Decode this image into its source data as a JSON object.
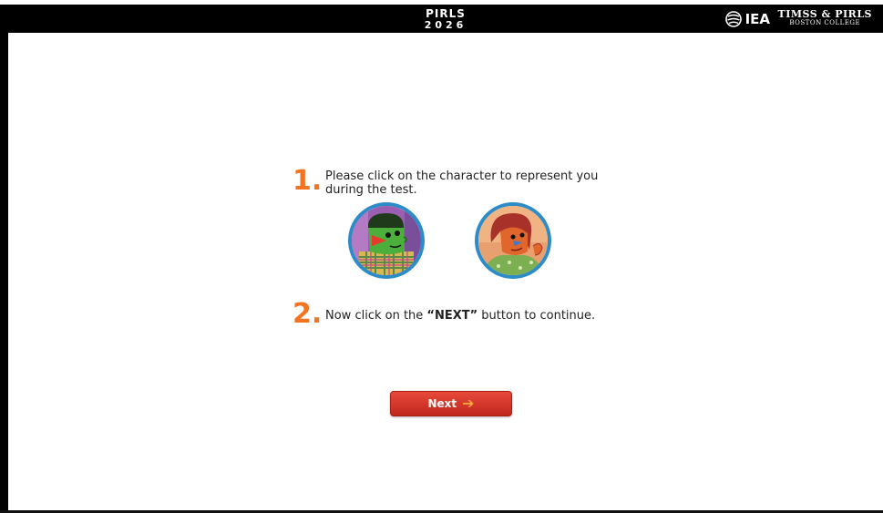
{
  "header": {
    "title_line1": "PIRLS",
    "title_line2": "2026",
    "iea_label": "IEA",
    "timss_line1": "TIMSS & PIRLS",
    "timss_line2": "BOSTON COLLEGE"
  },
  "instructions": {
    "step1_number": "1.",
    "step1_line1": "Please click on the character to represent you",
    "step1_line2": "during the test.",
    "step2_number": "2.",
    "step2_before": "Now click on the ",
    "step2_bold": "“NEXT”",
    "step2_after": " button to continue."
  },
  "characters": [
    {
      "name": "boy-character",
      "icon": "green-face-character"
    },
    {
      "name": "girl-character",
      "icon": "orange-face-character"
    }
  ],
  "next_button": {
    "label": "Next",
    "icon": "arrow-right-icon"
  },
  "colors": {
    "accent_orange": "#f27322",
    "button_red": "#d83a2c",
    "avatar_ring": "#2c8cc8",
    "header_bg": "#000000"
  }
}
